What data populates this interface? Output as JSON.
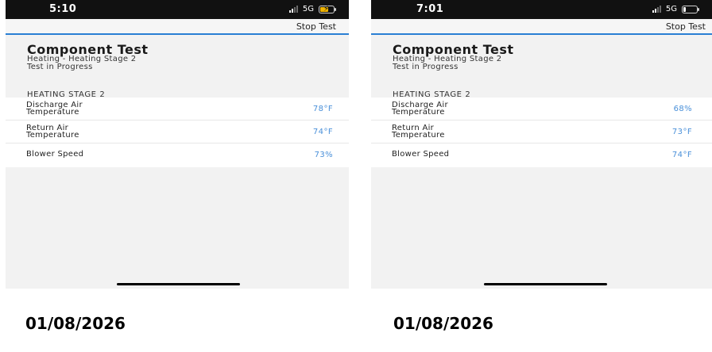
{
  "colors": {
    "status_bar": "#111111",
    "accent_line": "#2a7fd4",
    "value_text": "#4a90d9",
    "battery_left": "#f0b400",
    "battery_right": "#ffffff"
  },
  "screens": [
    {
      "status": {
        "time": "5:10",
        "network": "5G",
        "battery_icon": "battery-charging-icon"
      },
      "nav": {
        "stop_label": "Stop Test"
      },
      "title": "Component Test",
      "subtitle": "Heating - Heating Stage 2",
      "status_text": "Test in Progress",
      "section": "HEATING STAGE 2",
      "rows": [
        {
          "label_line1": "Discharge Air",
          "label_line2": "Temperature",
          "value": "78°F"
        },
        {
          "label_line1": "Return Air",
          "label_line2": "Temperature",
          "value": "74°F"
        },
        {
          "label_line1": "Blower Speed",
          "label_line2": "",
          "value": "73%"
        }
      ],
      "date": "01/08/2026"
    },
    {
      "status": {
        "time": "7:01",
        "network": "5G",
        "battery_icon": "battery-icon"
      },
      "nav": {
        "stop_label": "Stop Test"
      },
      "title": "Component Test",
      "subtitle": "Heating - Heating Stage 2",
      "status_text": "Test in Progress",
      "section": "HEATING STAGE 2",
      "rows": [
        {
          "label_line1": "Discharge Air",
          "label_line2": "Temperature",
          "value": "68%"
        },
        {
          "label_line1": "Return Air",
          "label_line2": "Temperature",
          "value": "73°F"
        },
        {
          "label_line1": "Blower Speed",
          "label_line2": "",
          "value": "74°F"
        }
      ],
      "date": "01/08/2026"
    }
  ]
}
